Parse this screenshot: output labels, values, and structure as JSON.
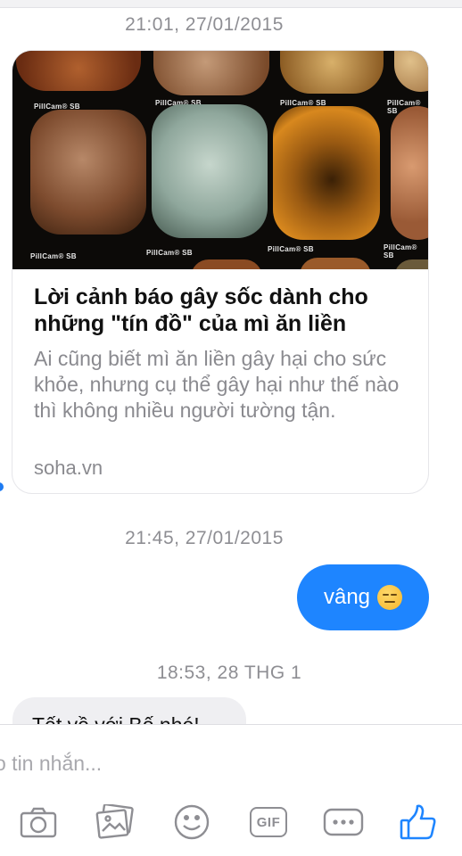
{
  "conversation": {
    "timestamps": [
      "21:01, 27/01/2015",
      "21:45, 27/01/2015",
      "18:53, 28 THG 1"
    ],
    "link_card": {
      "title": "Lời cảnh báo gây sốc dành cho những \"tín đồ\" của mì ăn liền",
      "description": "Ai cũng biết mì ăn liền gây hại cho sức khỏe, nhưng cụ thể gây hại như thế nào thì không nhiều người tường tận.",
      "source": "soha.vn",
      "thumbnail_labels": [
        "PillCam® SB",
        "PillCam® SB",
        "PillCam® SB",
        "PillCam® SB",
        "PillCam® SB",
        "PillCam® SB",
        "PillCam® SB",
        "PillCam® SB"
      ]
    },
    "outgoing_message": "vâng",
    "outgoing_emoji": "expressionless-face",
    "incoming_message_partial": "Tết về với Bố nhé!"
  },
  "composer": {
    "placeholder": "o tin nhắn..."
  },
  "toolbar": {
    "icons": [
      "camera-icon",
      "photo-icon",
      "emoji-icon",
      "gif-icon",
      "more-icon",
      "like-icon"
    ],
    "gif_label": "GIF",
    "accent_color": "#1e85ff",
    "icon_color": "#8e8e93"
  }
}
